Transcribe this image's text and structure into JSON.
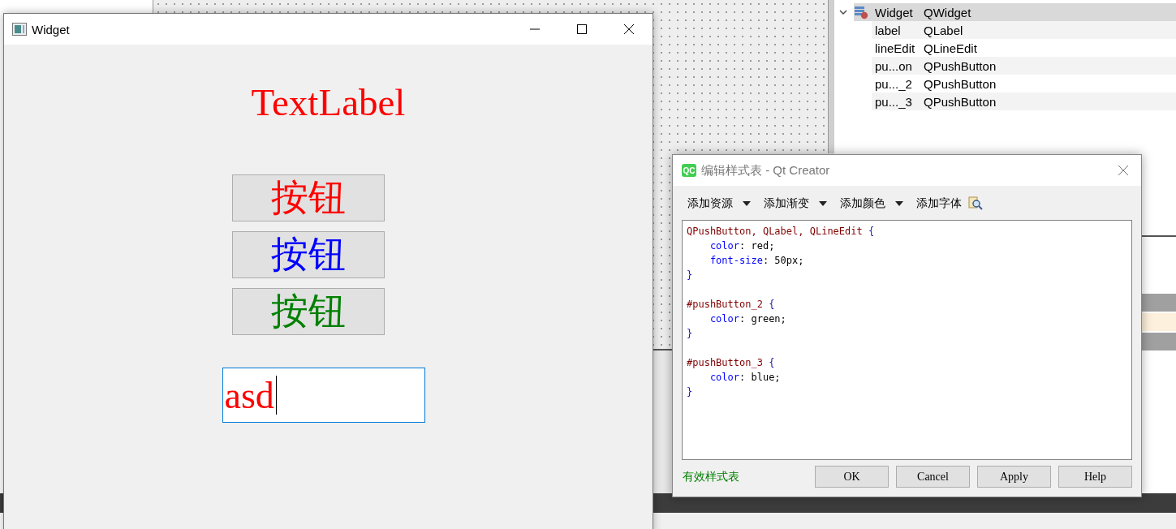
{
  "object_inspector": [
    {
      "object": "Widget",
      "class": "QWidget",
      "selected": true,
      "expanded": true,
      "children": [
        {
          "object": "label",
          "class": "QLabel",
          "selected": false
        },
        {
          "object": "lineEdit",
          "class": "QLineEdit",
          "selected": false
        },
        {
          "object": "pu...on",
          "class": "QPushButton",
          "selected": false
        },
        {
          "object": "pu..._2",
          "class": "QPushButton",
          "selected": false
        },
        {
          "object": "pu..._3",
          "class": "QPushButton",
          "selected": false
        }
      ]
    }
  ],
  "widget_window": {
    "title": "Widget",
    "label": "TextLabel",
    "buttons": [
      {
        "text": "按钮",
        "color": "#ff0000"
      },
      {
        "text": "按钮",
        "color": "#0000ff"
      },
      {
        "text": "按钮",
        "color": "#008000"
      }
    ],
    "line_edit": {
      "value": "asd",
      "focused": true
    }
  },
  "stylesheet_dialog": {
    "logo": "QC",
    "title": "编辑样式表 - Qt Creator",
    "toolbar": [
      {
        "label": "添加资源",
        "kind": "dropdown"
      },
      {
        "label": "添加渐变",
        "kind": "dropdown"
      },
      {
        "label": "添加颜色",
        "kind": "dropdown"
      },
      {
        "label": "添加字体",
        "kind": "button"
      }
    ],
    "code": [
      {
        "kind": "rule",
        "tokens": [
          {
            "kind": "selector",
            "text": "QPushButton, QLabel, QLineEdit"
          },
          {
            "kind": "brace",
            "text": " {"
          }
        ]
      },
      {
        "kind": "declaration",
        "tokens": [
          {
            "kind": "property",
            "text": "color"
          },
          {
            "kind": "plain",
            "text": ": red;"
          }
        ]
      },
      {
        "kind": "declaration",
        "tokens": [
          {
            "kind": "property",
            "text": "font-size"
          },
          {
            "kind": "plain",
            "text": ": 50px;"
          }
        ]
      },
      {
        "kind": "rule",
        "tokens": [
          {
            "kind": "brace",
            "text": "}"
          }
        ]
      },
      {
        "kind": "blank"
      },
      {
        "kind": "rule",
        "tokens": [
          {
            "kind": "selector",
            "text": "#pushButton_2"
          },
          {
            "kind": "brace",
            "text": " {"
          }
        ]
      },
      {
        "kind": "declaration",
        "tokens": [
          {
            "kind": "property",
            "text": "color"
          },
          {
            "kind": "plain",
            "text": ": green;"
          }
        ]
      },
      {
        "kind": "rule",
        "tokens": [
          {
            "kind": "brace",
            "text": "}"
          }
        ]
      },
      {
        "kind": "blank"
      },
      {
        "kind": "rule",
        "tokens": [
          {
            "kind": "selector",
            "text": "#pushButton_3"
          },
          {
            "kind": "brace",
            "text": " {"
          }
        ]
      },
      {
        "kind": "declaration",
        "tokens": [
          {
            "kind": "property",
            "text": "color"
          },
          {
            "kind": "plain",
            "text": ": blue;"
          }
        ]
      },
      {
        "kind": "rule",
        "tokens": [
          {
            "kind": "brace",
            "text": "}"
          }
        ]
      }
    ],
    "status": "有效样式表",
    "buttons": [
      "OK",
      "Cancel",
      "Apply",
      "Help"
    ]
  }
}
